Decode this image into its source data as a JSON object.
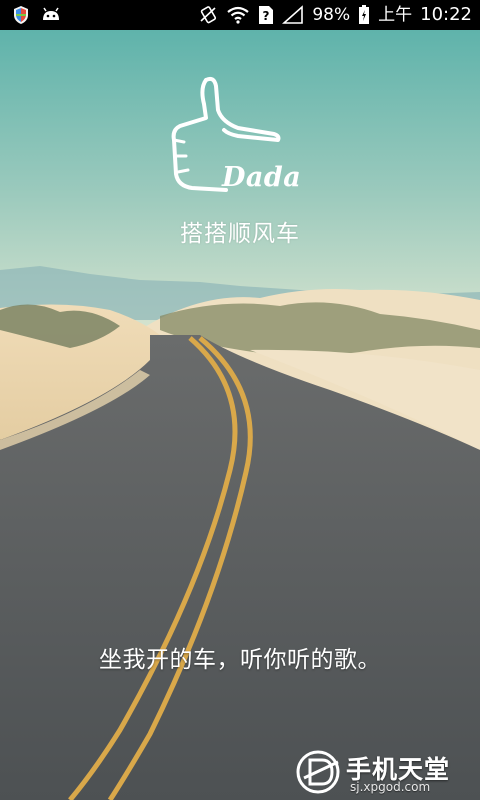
{
  "status_bar": {
    "battery_percent": "98%",
    "am_pm": "上午",
    "time": "10:22",
    "left_icons": [
      "shield-icon",
      "android-icon"
    ],
    "right_icons": [
      "vibrate-icon",
      "wifi-icon",
      "sim-unknown-icon",
      "signal-icon",
      "battery-icon"
    ]
  },
  "splash": {
    "logo_word": "Dada",
    "app_name": "搭搭顺风车",
    "tagline": "坐我开的车，听你听的歌。"
  },
  "watermark": {
    "title": "手机天堂",
    "url": "sj.xpgod.com"
  },
  "colors": {
    "sky_top": "#5fb3ab",
    "sky_bottom": "#cfe0cf",
    "sand": "#e8d5b0",
    "road": "#55585a",
    "lane_yellow": "#d9a84a",
    "text": "#ffffff"
  }
}
